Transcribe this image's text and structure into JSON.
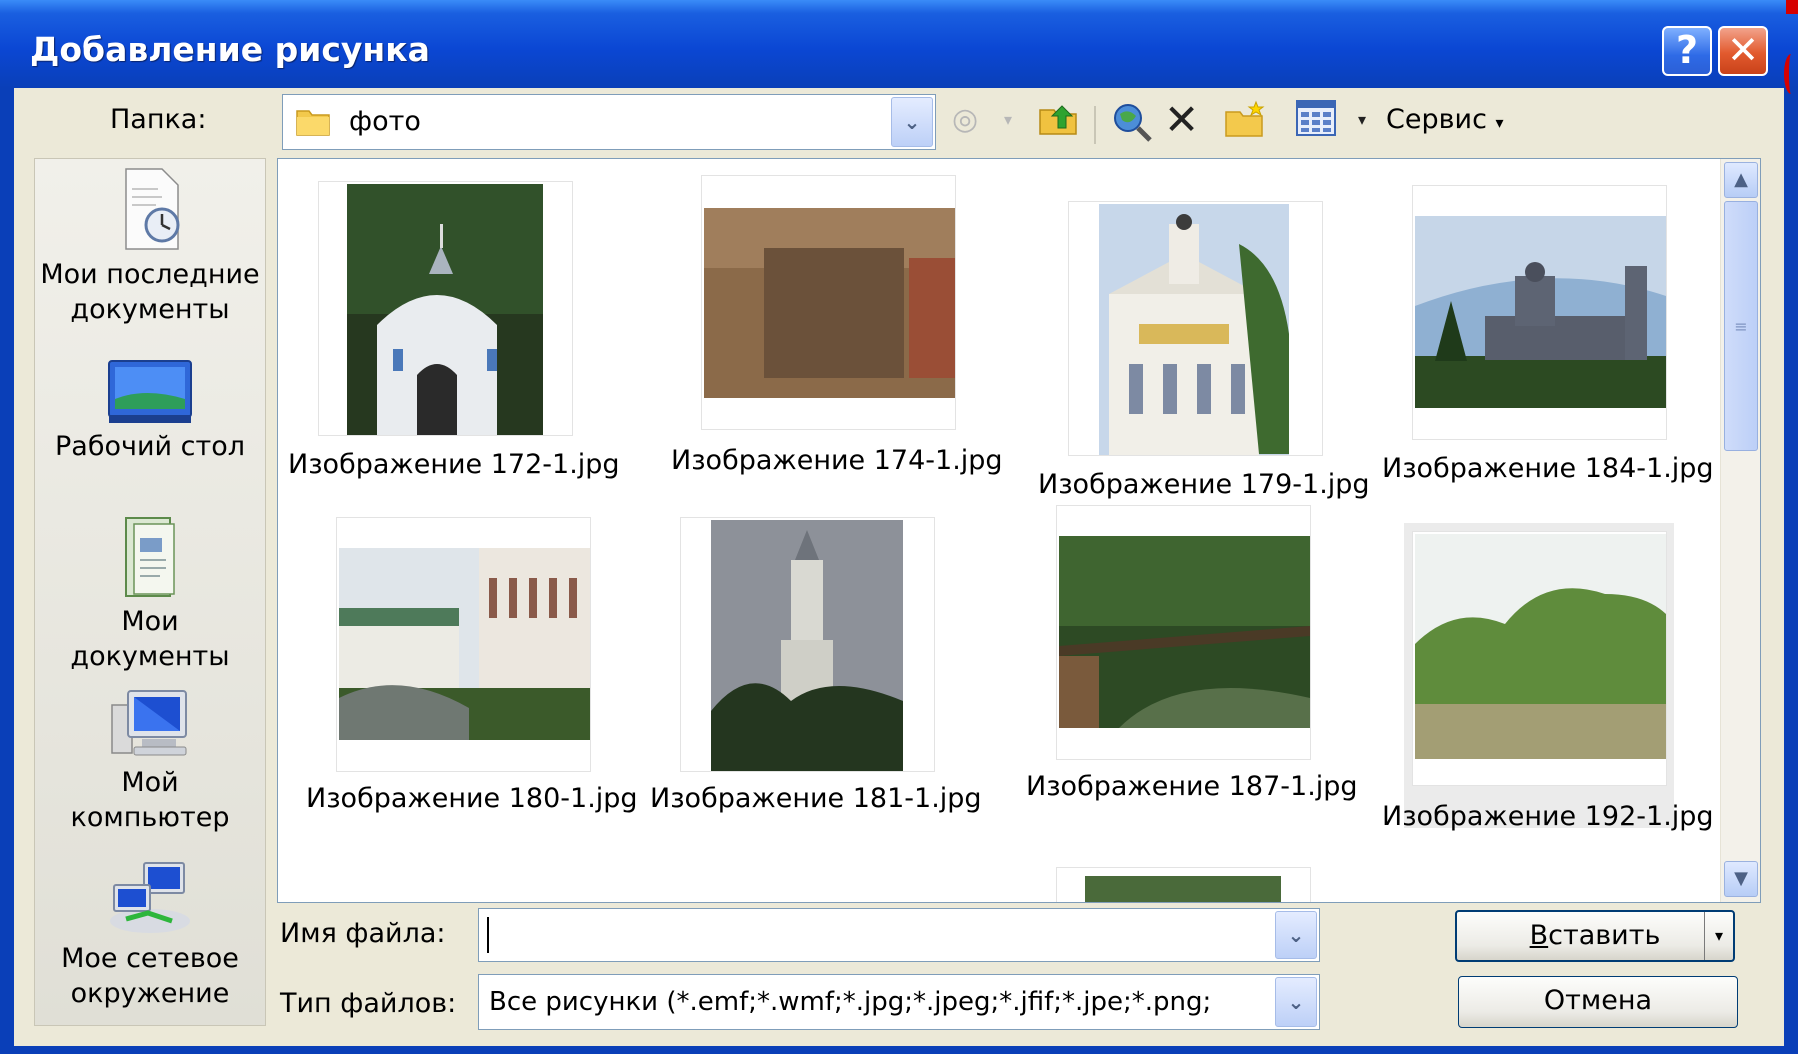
{
  "window": {
    "title": "Добавление рисунка",
    "help_glyph": "?",
    "close_glyph": "✕"
  },
  "folder": {
    "label": "Папка:",
    "value": "фото"
  },
  "toolbar": {
    "service_label": "Сервис",
    "icons": [
      "back-icon",
      "up-folder-icon",
      "web-search-icon",
      "delete-icon",
      "new-folder-icon",
      "views-icon"
    ]
  },
  "places": [
    {
      "icon": "recent-documents-icon",
      "line1": "Мои последние",
      "line2": "документы"
    },
    {
      "icon": "desktop-icon",
      "line1": "Рабочий стол",
      "line2": ""
    },
    {
      "icon": "my-documents-icon",
      "line1": "Мои",
      "line2": "документы"
    },
    {
      "icon": "my-computer-icon",
      "line1": "Мой",
      "line2": "компьютер"
    },
    {
      "icon": "network-places-icon",
      "line1": "Мое сетевое",
      "line2": "окружение"
    }
  ],
  "files": [
    {
      "name": "Изображение 172-1.jpg"
    },
    {
      "name": "Изображение 174-1.jpg"
    },
    {
      "name": "Изображение 179-1.jpg"
    },
    {
      "name": "Изображение 184-1.jpg"
    },
    {
      "name": "Изображение 180-1.jpg"
    },
    {
      "name": "Изображение 181-1.jpg"
    },
    {
      "name": "Изображение 187-1.jpg"
    },
    {
      "name": "Изображение 192-1.jpg"
    }
  ],
  "filename": {
    "label": "Имя файла:",
    "value": ""
  },
  "filetype": {
    "label": "Тип файлов:",
    "value": "Все рисунки (*.emf;*.wmf;*.jpg;*.jpeg;*.jfif;*.jpe;*.png;"
  },
  "buttons": {
    "insert_accel": "В",
    "insert_rest": "ставить",
    "cancel": "Отмена"
  }
}
